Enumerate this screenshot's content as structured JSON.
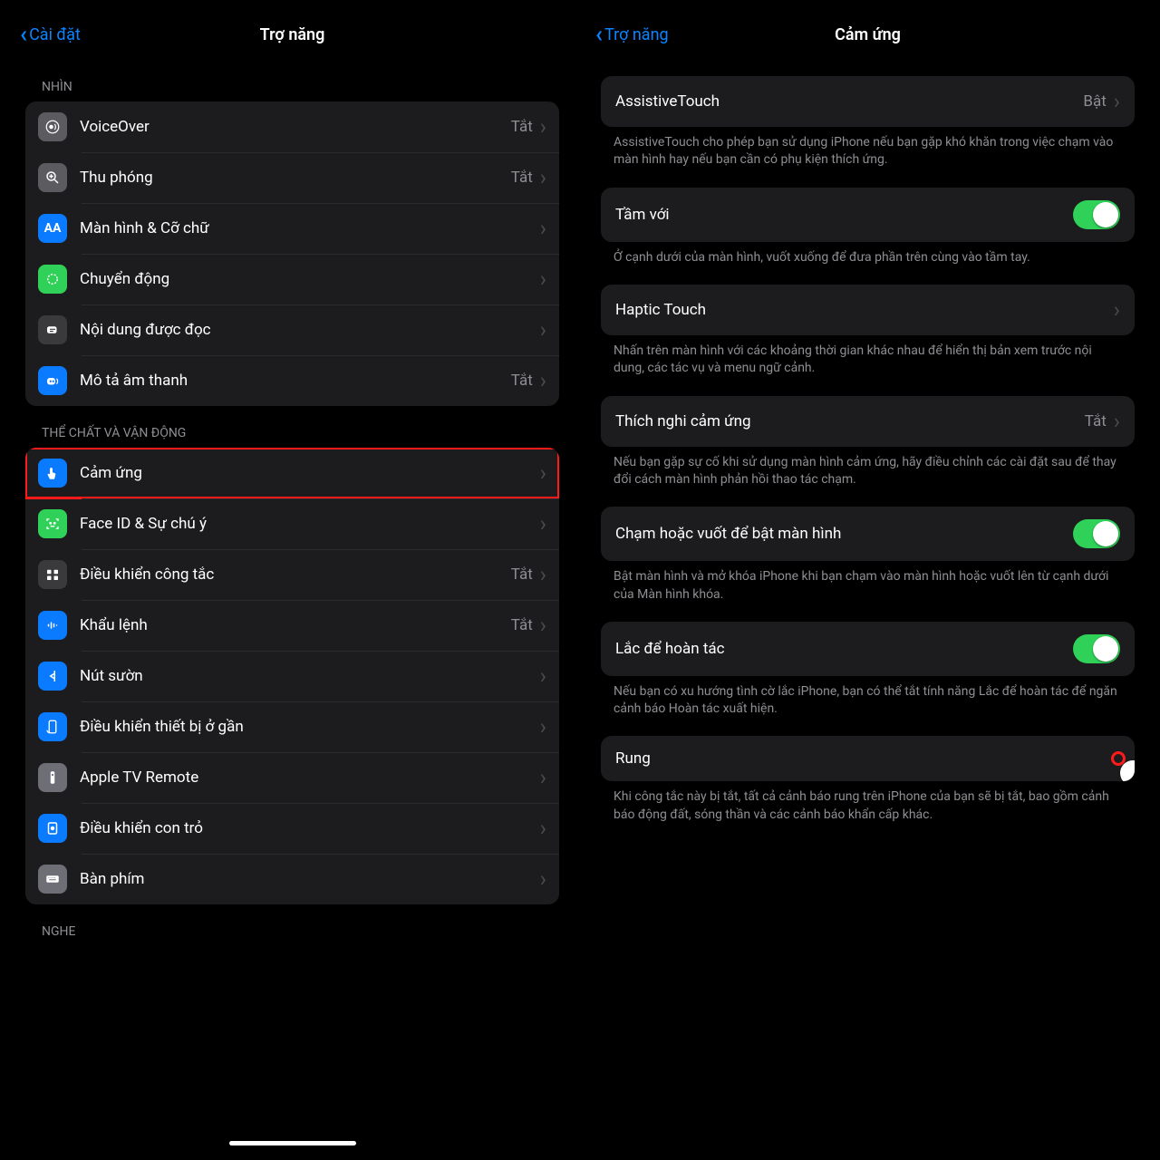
{
  "left": {
    "back": "Cài đặt",
    "title": "Trợ năng",
    "section_vision": "NHÌN",
    "section_physical": "THỂ CHẤT VÀ VẬN ĐỘNG",
    "section_hearing": "NGHE",
    "rows": {
      "voiceover": {
        "label": "VoiceOver",
        "value": "Tắt"
      },
      "zoom": {
        "label": "Thu phóng",
        "value": "Tắt"
      },
      "display": {
        "label": "Màn hình & Cỡ chữ",
        "value": ""
      },
      "motion": {
        "label": "Chuyển động",
        "value": ""
      },
      "spoken": {
        "label": "Nội dung được đọc",
        "value": ""
      },
      "audio_desc": {
        "label": "Mô tả âm thanh",
        "value": "Tắt"
      },
      "touch": {
        "label": "Cảm ứng",
        "value": ""
      },
      "faceid": {
        "label": "Face ID & Sự chú ý",
        "value": ""
      },
      "switch": {
        "label": "Điều khiển công tắc",
        "value": "Tắt"
      },
      "voice_control": {
        "label": "Khẩu lệnh",
        "value": "Tắt"
      },
      "side_button": {
        "label": "Nút sườn",
        "value": ""
      },
      "nearby": {
        "label": "Điều khiển thiết bị ở gần",
        "value": ""
      },
      "apple_tv": {
        "label": "Apple TV Remote",
        "value": ""
      },
      "pointer": {
        "label": "Điều khiển con trỏ",
        "value": ""
      },
      "keyboard": {
        "label": "Bàn phím",
        "value": ""
      }
    }
  },
  "right": {
    "back": "Trợ năng",
    "title": "Cảm ứng",
    "groups": {
      "at": {
        "label": "AssistiveTouch",
        "value": "Bật"
      },
      "at_foot": "AssistiveTouch cho phép bạn sử dụng iPhone nếu bạn gặp khó khăn trong việc chạm vào màn hình hay nếu bạn cần có phụ kiện thích ứng.",
      "reach": {
        "label": "Tầm với"
      },
      "reach_foot": "Ở cạnh dưới của màn hình, vuốt xuống để đưa phần trên cùng vào tầm tay.",
      "haptic": {
        "label": "Haptic Touch"
      },
      "haptic_foot": "Nhấn trên màn hình với các khoảng thời gian khác nhau để hiển thị bản xem trước nội dung, các tác vụ và menu ngữ cảnh.",
      "accom": {
        "label": "Thích nghi cảm ứng",
        "value": "Tắt"
      },
      "accom_foot": "Nếu bạn gặp sự cố khi sử dụng màn hình cảm ứng, hãy điều chỉnh các cài đặt sau để thay đổi cách màn hình phản hồi thao tác chạm.",
      "tap_wake": {
        "label": "Chạm hoặc vuốt để bật màn hình"
      },
      "tap_wake_foot": "Bật màn hình và mở khóa iPhone khi bạn chạm vào màn hình hoặc vuốt lên từ cạnh dưới của Màn hình khóa.",
      "shake": {
        "label": "Lắc để hoàn tác"
      },
      "shake_foot": "Nếu bạn có xu hướng tình cờ lắc iPhone, bạn có thể tắt tính năng Lắc để hoàn tác để ngăn cảnh báo Hoàn tác xuất hiện.",
      "vibration": {
        "label": "Rung"
      },
      "vibration_foot": "Khi công tắc này bị tắt, tất cả cảnh báo rung trên iPhone của bạn sẽ bị tắt, bao gồm cảnh báo động đất, sóng thần và các cảnh báo khẩn cấp khác."
    }
  }
}
